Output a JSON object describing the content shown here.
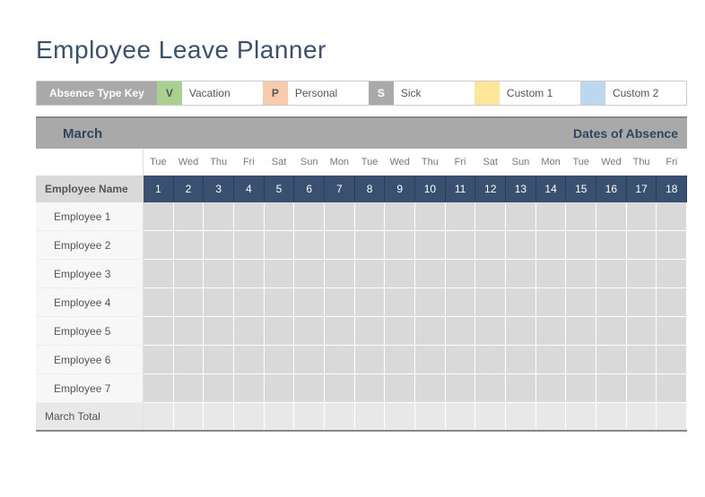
{
  "title": "Employee Leave Planner",
  "legend": {
    "label": "Absence Type Key",
    "items": [
      {
        "code": "V",
        "label": "Vacation",
        "class": "sw-v"
      },
      {
        "code": "P",
        "label": "Personal",
        "class": "sw-p"
      },
      {
        "code": "S",
        "label": "Sick",
        "class": "sw-s"
      },
      {
        "code": "",
        "label": "Custom 1",
        "class": "sw-c1"
      },
      {
        "code": "",
        "label": "Custom 2",
        "class": "sw-c2"
      }
    ]
  },
  "month": {
    "name": "March",
    "right_label": "Dates of Absence",
    "header_label": "Employee Name",
    "total_label": "March Total",
    "weekdays": [
      "Tue",
      "Wed",
      "Thu",
      "Fri",
      "Sat",
      "Sun",
      "Mon",
      "Tue",
      "Wed",
      "Thu",
      "Fri",
      "Sat",
      "Sun",
      "Mon",
      "Tue",
      "Wed",
      "Thu",
      "Fri"
    ],
    "dates": [
      "1",
      "2",
      "3",
      "4",
      "5",
      "6",
      "7",
      "8",
      "9",
      "10",
      "11",
      "12",
      "13",
      "14",
      "15",
      "16",
      "17",
      "18"
    ],
    "employees": [
      "Employee 1",
      "Employee 2",
      "Employee 3",
      "Employee 4",
      "Employee 5",
      "Employee 6",
      "Employee 7"
    ]
  }
}
